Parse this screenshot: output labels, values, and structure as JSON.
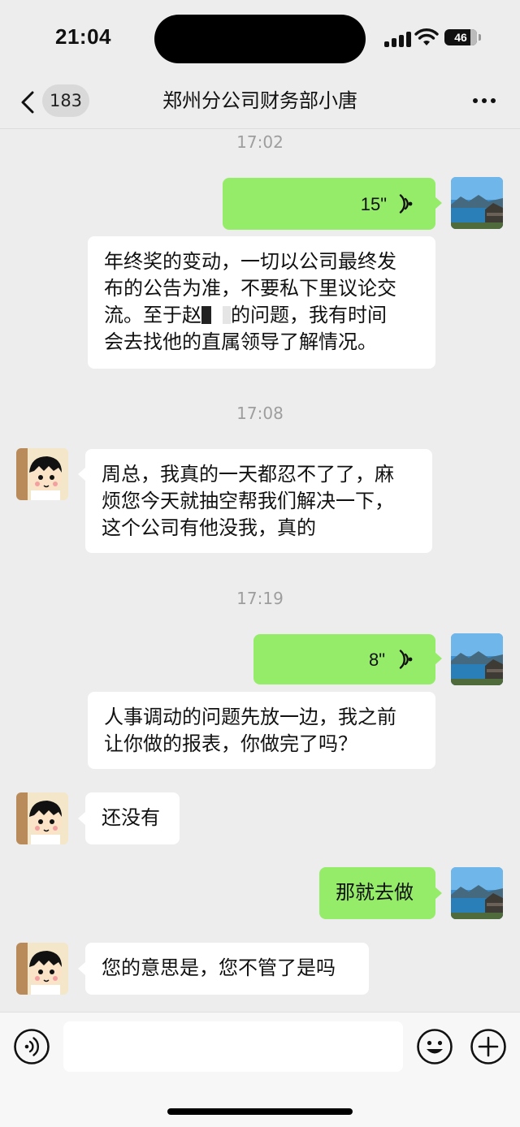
{
  "status_bar": {
    "time": "21:04",
    "battery": "46"
  },
  "nav": {
    "unread_count": "183",
    "title": "郑州分公司财务部小唐"
  },
  "messages": {
    "ts1": "17:02",
    "voice1": "15\"",
    "m1": "年终奖的变动，一切以公司最终发\n布的公告为准，不要私下里议论交\n流。至于赵",
    "m1_rest": "的问题，我有时间\n会去找他的直属领导了解情况。",
    "ts2": "17:08",
    "m2": "周总，我真的一天都忍不了了，麻\n烦您今天就抽空帮我们解决一下，\n这个公司有他没我，真的",
    "ts3": "17:19",
    "voice2": "8\"",
    "m3": "人事调动的问题先放一边，我之前\n让你做的报表，你做完了吗？",
    "m4": "还没有",
    "m5": "那就去做",
    "m6": "您的意思是，您不管了是吗"
  },
  "colors": {
    "out_bubble": "#95ec69",
    "in_bubble": "#ffffff",
    "background": "#ededed"
  }
}
